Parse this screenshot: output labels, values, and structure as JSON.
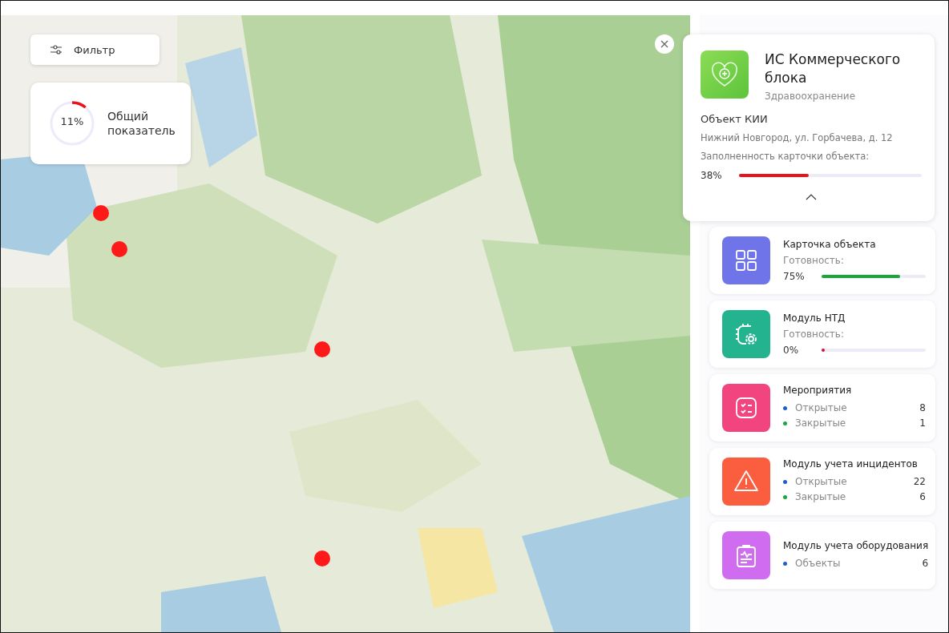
{
  "filter_button": {
    "label": "Фильтр"
  },
  "overall": {
    "value": "11%",
    "level": 0.11,
    "label": "Общий показатель"
  },
  "object_card": {
    "title": "ИС Коммерческого блока",
    "category": "Здравоохранение",
    "type": "Объект КИИ",
    "address": "Нижний Новгород, ул. Горбачева, д. 12",
    "fill_label": "Заполненность карточки объекта:",
    "fill_value": "38%",
    "level": 0.38,
    "expanded": true
  },
  "modules": [
    {
      "kind": "progress",
      "title": "Карточка объекта",
      "color": "#6f74e8",
      "caption": "Готовность:",
      "value": "75%",
      "level": 0.75
    },
    {
      "kind": "progress",
      "title": "Модуль НТД",
      "color": "#23b48f",
      "caption": "Готовность:",
      "value": "0%",
      "level": 0
    },
    {
      "kind": "counts",
      "title": "Мероприятия",
      "color": "#f2447e",
      "counts": [
        {
          "label": "Открытые",
          "value": "8",
          "color": "#1a5fd0"
        },
        {
          "label": "Закрытые",
          "value": "1",
          "color": "#19a83a"
        }
      ]
    },
    {
      "kind": "counts",
      "title": "Модуль учета инцидентов",
      "color": "#fb5d3f",
      "counts": [
        {
          "label": "Открытые",
          "value": "22",
          "color": "#1a5fd0"
        },
        {
          "label": "Закрытые",
          "value": "6",
          "color": "#19a83a"
        }
      ]
    },
    {
      "kind": "counts",
      "title": "Модуль учета оборудования",
      "color": "#cf6cf0",
      "counts": [
        {
          "label": "Объекты",
          "value": "6",
          "color": "#1a5fd0"
        }
      ]
    }
  ]
}
